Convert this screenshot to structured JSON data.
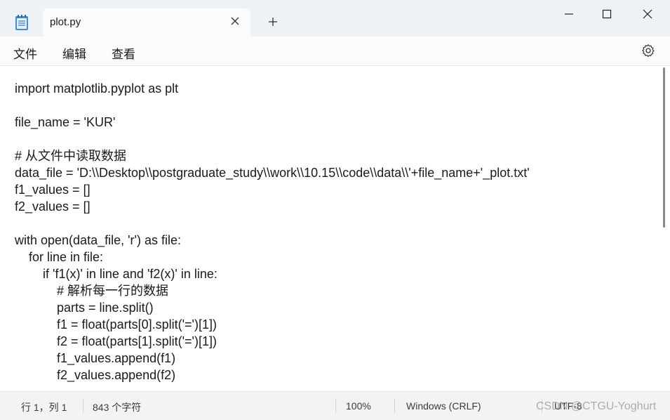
{
  "tab": {
    "title": "plot.py"
  },
  "menu": {
    "file": "文件",
    "edit": "编辑",
    "view": "查看"
  },
  "icons": {
    "app": "notepad-icon",
    "tab_close": "close-icon",
    "new_tab": "plus-icon",
    "minimize": "minimize-icon",
    "maximize": "maximize-icon",
    "close": "close-icon",
    "settings": "gear-icon"
  },
  "editor": {
    "lines": [
      "import matplotlib.pyplot as plt",
      "",
      "file_name = 'KUR'",
      "",
      "# 从文件中读取数据",
      "data_file = 'D:\\\\Desktop\\\\postgraduate_study\\\\work\\\\10.15\\\\code\\\\data\\\\'+file_name+'_plot.txt'",
      "f1_values = []",
      "f2_values = []",
      "",
      "with open(data_file, 'r') as file:",
      "    for line in file:",
      "        if 'f1(x)' in line and 'f2(x)' in line:",
      "            # 解析每一行的数据",
      "            parts = line.split()",
      "            f1 = float(parts[0].split('=')[1])",
      "            f2 = float(parts[1].split('=')[1])",
      "            f1_values.append(f1)",
      "            f2_values.append(f2)"
    ]
  },
  "status": {
    "position": "行 1，列 1",
    "char_count": "843 个字符",
    "zoom": "100%",
    "line_ending": "Windows (CRLF)",
    "encoding": "UTF-8"
  },
  "watermark": "CSDN @CTGU-Yoghurt"
}
